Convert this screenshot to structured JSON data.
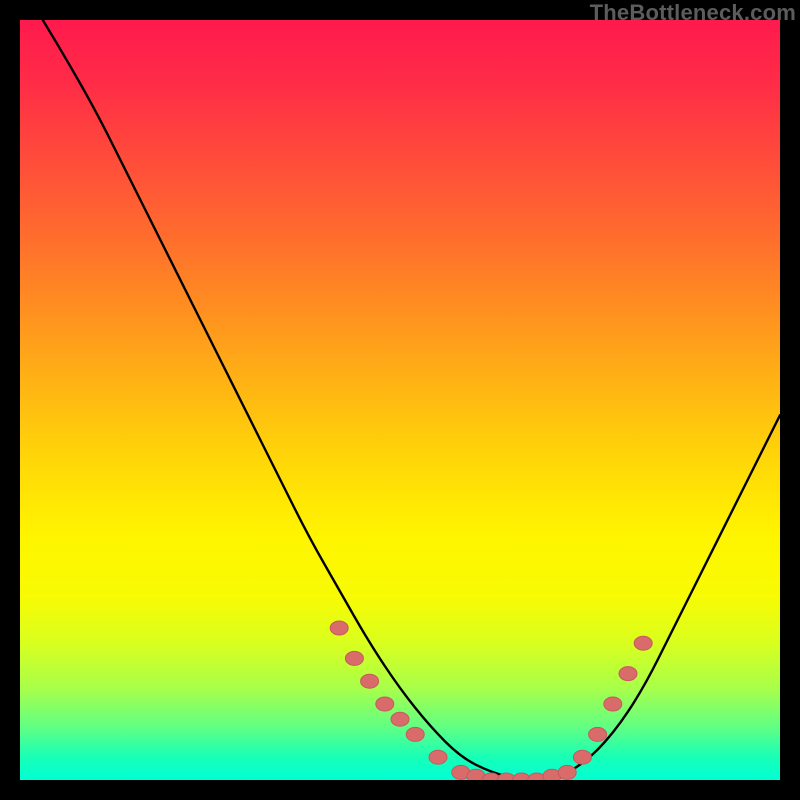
{
  "watermark": "TheBottleneck.com",
  "colors": {
    "curve_stroke": "#000000",
    "marker_fill": "#d96b6b",
    "marker_stroke": "#c65a5a"
  },
  "chart_data": {
    "type": "line",
    "title": "",
    "xlabel": "",
    "ylabel": "",
    "xlim": [
      0,
      100
    ],
    "ylim": [
      0,
      100
    ],
    "grid": false,
    "legend": false,
    "series": [
      {
        "name": "bottleneck-curve",
        "x": [
          3,
          6,
          10,
          14,
          18,
          22,
          26,
          30,
          34,
          38,
          42,
          46,
          50,
          54,
          58,
          62,
          66,
          70,
          74,
          78,
          82,
          86,
          90,
          94,
          98,
          100
        ],
        "y": [
          100,
          95,
          88,
          80,
          72,
          64,
          56,
          48,
          40,
          32,
          25,
          18,
          12,
          7,
          3,
          1,
          0,
          0,
          2,
          6,
          12,
          20,
          28,
          36,
          44,
          48
        ]
      }
    ],
    "markers": [
      {
        "x": 42,
        "y": 20
      },
      {
        "x": 44,
        "y": 16
      },
      {
        "x": 46,
        "y": 13
      },
      {
        "x": 48,
        "y": 10
      },
      {
        "x": 50,
        "y": 8
      },
      {
        "x": 52,
        "y": 6
      },
      {
        "x": 55,
        "y": 3
      },
      {
        "x": 58,
        "y": 1
      },
      {
        "x": 60,
        "y": 0.5
      },
      {
        "x": 62,
        "y": 0
      },
      {
        "x": 64,
        "y": 0
      },
      {
        "x": 66,
        "y": 0
      },
      {
        "x": 68,
        "y": 0
      },
      {
        "x": 70,
        "y": 0.5
      },
      {
        "x": 72,
        "y": 1
      },
      {
        "x": 74,
        "y": 3
      },
      {
        "x": 76,
        "y": 6
      },
      {
        "x": 78,
        "y": 10
      },
      {
        "x": 80,
        "y": 14
      },
      {
        "x": 82,
        "y": 18
      }
    ]
  }
}
